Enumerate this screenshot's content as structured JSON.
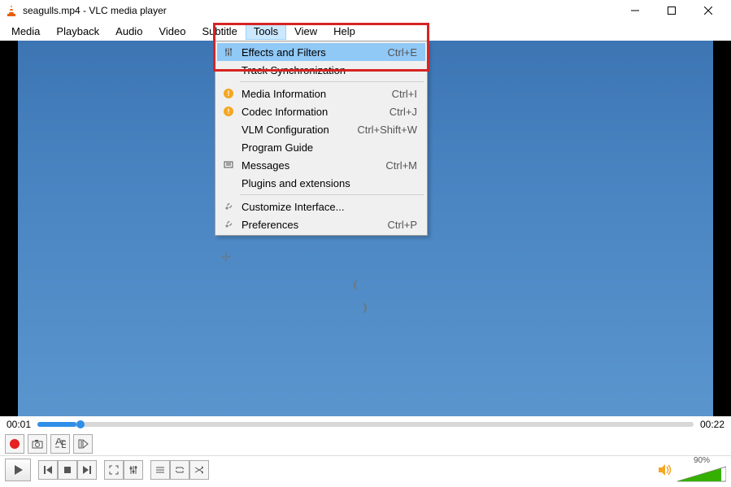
{
  "titlebar": {
    "title": "seagulls.mp4 - VLC media player"
  },
  "menubar": {
    "items": [
      "Media",
      "Playback",
      "Audio",
      "Video",
      "Subtitle",
      "Tools",
      "View",
      "Help"
    ],
    "active_index": 5
  },
  "dropdown": {
    "rows": [
      {
        "icon": "sliders",
        "label": "Effects and Filters",
        "shortcut": "Ctrl+E",
        "highlight": true
      },
      {
        "icon": "",
        "label": "Track Synchronization",
        "shortcut": ""
      },
      {
        "sep": true
      },
      {
        "icon": "warn",
        "label": "Media Information",
        "shortcut": "Ctrl+I"
      },
      {
        "icon": "warn",
        "label": "Codec Information",
        "shortcut": "Ctrl+J"
      },
      {
        "icon": "",
        "label": "VLM Configuration",
        "shortcut": "Ctrl+Shift+W"
      },
      {
        "icon": "",
        "label": "Program Guide",
        "shortcut": ""
      },
      {
        "icon": "msg",
        "label": "Messages",
        "shortcut": "Ctrl+M"
      },
      {
        "icon": "",
        "label": "Plugins and extensions",
        "shortcut": ""
      },
      {
        "sep": true
      },
      {
        "icon": "wrench",
        "label": "Customize Interface...",
        "shortcut": ""
      },
      {
        "icon": "wrench",
        "label": "Preferences",
        "shortcut": "Ctrl+P"
      }
    ]
  },
  "time": {
    "current": "00:01",
    "total": "00:22"
  },
  "volume": {
    "percent_label": "90%",
    "percent": 90
  }
}
